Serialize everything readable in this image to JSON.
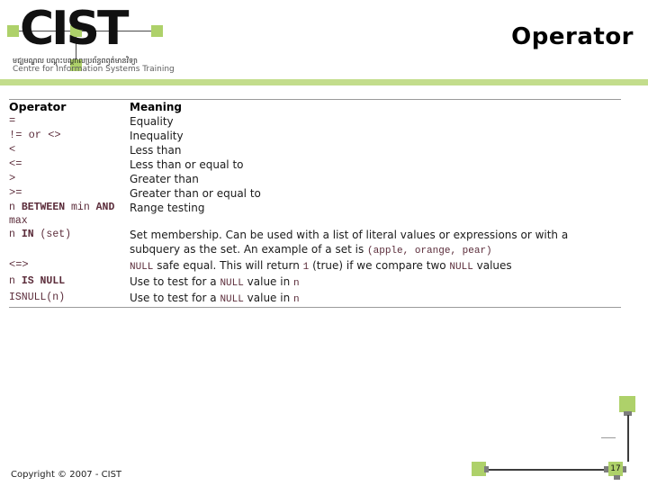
{
  "header": {
    "logo": {
      "wordmark": "CIST",
      "khmer_line": "មជ្ឃមណ្ឌល    បណ្តុះបណ្តាលប្រព័ន្ធពឭត៌មានវិទ្យា",
      "english_line": "Centre for  Information Systems Training",
      "node_color": "#aed16a"
    },
    "title": "Operator",
    "bar_color": "#c3dd8c"
  },
  "table": {
    "columns": [
      "Operator",
      "Meaning"
    ],
    "rows": [
      {
        "operator": "=",
        "operator_kind": "sym",
        "meaning": "Equality"
      },
      {
        "operator": "!= or <>",
        "operator_kind": "sym",
        "meaning": "Inequality"
      },
      {
        "operator": "<",
        "operator_kind": "sym",
        "meaning": "Less than"
      },
      {
        "operator": "<=",
        "operator_kind": "sym",
        "meaning": "Less than or equal to"
      },
      {
        "operator": ">",
        "operator_kind": "sym",
        "meaning": "Greater than"
      },
      {
        "operator": ">=",
        "operator_kind": "sym",
        "meaning": "Greater than or equal to"
      },
      {
        "operator": "n BETWEEN min AND max",
        "operator_kind": "code",
        "meaning": "Range testing"
      },
      {
        "operator": "n IN (set)",
        "operator_kind": "code",
        "meaning": "Set membership. Can be used with a list of literal values or expressions or with a subquery as the set. An example of a set is (apple, orange, pear)"
      },
      {
        "operator": "<=>",
        "operator_kind": "sym",
        "meaning": "NULL safe equal. This will return 1 (true) if we compare two NULL values"
      },
      {
        "operator": "n IS NULL",
        "operator_kind": "code",
        "meaning": "Use to test for a NULL value in n"
      },
      {
        "operator": "ISNULL(n)",
        "operator_kind": "code",
        "meaning": "Use to test for a NULL value in n"
      }
    ]
  },
  "footer": {
    "copyright": "Copyright © 2007 - CIST",
    "page_number": "17"
  }
}
